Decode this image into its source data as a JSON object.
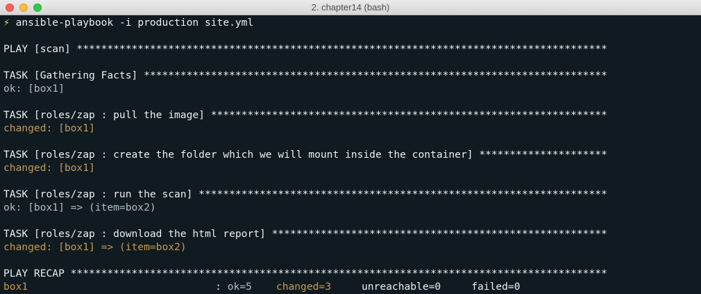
{
  "window": {
    "title": "2. chapter14 (bash)"
  },
  "colors": {
    "background": "#0f1a21",
    "text": "#ecf0f1",
    "ok": "#b3bdc3",
    "changed": "#c99b55",
    "prompt_symbol": "#f7d84a"
  },
  "prompt": {
    "symbol": "⚡",
    "command": "ansible-playbook -i production site.yml"
  },
  "output": {
    "play_scan": "PLAY [scan] ***************************************************************************************",
    "task1_header": "TASK [Gathering Facts] ****************************************************************************",
    "task1_status": "ok: [box1]",
    "task2_header": "TASK [roles/zap : pull the image] *****************************************************************",
    "task2_status": "changed: [box1]",
    "task3_header": "TASK [roles/zap : create the folder which we will mount inside the container] *********************",
    "task3_status": "changed: [box1]",
    "task4_header": "TASK [roles/zap : run the scan] *******************************************************************",
    "task4_status": "ok: [box1] => (item=box2)",
    "task5_header": "TASK [roles/zap : download the html report] *******************************************************",
    "task5_status": "changed: [box1] => (item=box2)",
    "recap_header": "PLAY RECAP ****************************************************************************************"
  },
  "recap": {
    "host": "box1",
    "separator": ":",
    "ok": "ok=5",
    "changed": "changed=3",
    "unreachable": "unreachable=0",
    "failed": "failed=0"
  }
}
